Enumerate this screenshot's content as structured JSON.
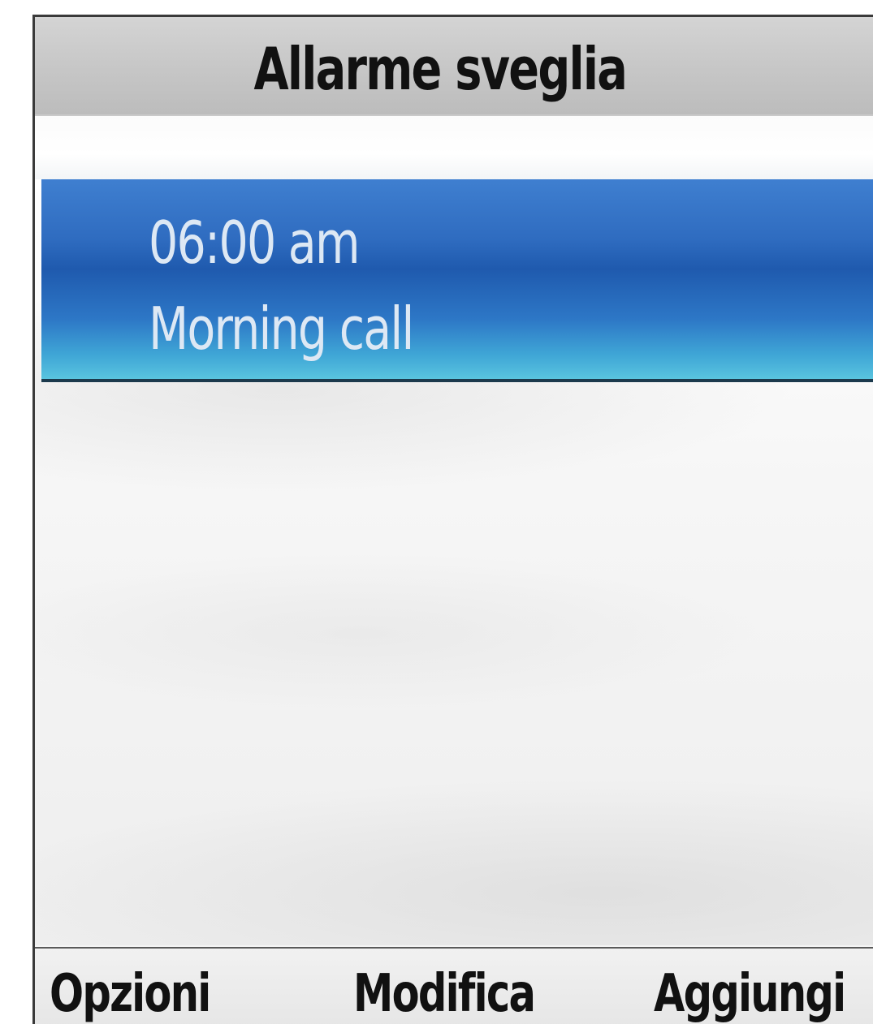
{
  "screen": {
    "title": "Allarme sveglia"
  },
  "alarms": [
    {
      "time": "06:00 am",
      "label": "Morning call",
      "selected": true
    }
  ],
  "softkeys": {
    "left": "Opzioni",
    "center": "Modifica",
    "right": "Aggiungi"
  },
  "colors": {
    "selection_top": "#3f7fd0",
    "selection_bottom": "#59c4df",
    "selection_text": "#dde8f4",
    "title_bar": "#c6c6c6",
    "text": "#111111"
  }
}
